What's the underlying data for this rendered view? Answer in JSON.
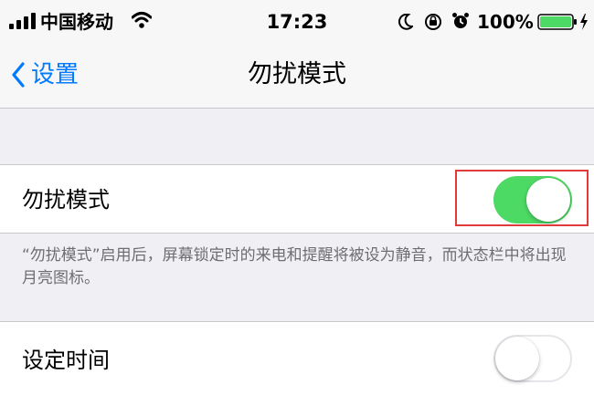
{
  "status_bar": {
    "carrier": "中国移动",
    "time": "17:23",
    "battery_percent": "100%",
    "battery_level": 1.0,
    "icons": [
      "signal-icon",
      "wifi-icon",
      "moon-icon",
      "rotation-lock-icon",
      "alarm-icon",
      "battery-icon",
      "charging-icon"
    ]
  },
  "nav": {
    "back_label": "设置",
    "title": "勿扰模式"
  },
  "dnd_cell": {
    "label": "勿扰模式",
    "toggle_on": true
  },
  "dnd_footer": "“勿扰模式”启用后，屏幕锁定时的来电和提醒将被设为静音，而状态栏中将出现月亮图标。",
  "scheduled_cell": {
    "label": "设定时间",
    "toggle_on": false
  },
  "colors": {
    "accent": "#007aff",
    "toggle_on": "#4cd964",
    "highlight": "#e03a3a",
    "battery": "#4cd964"
  }
}
